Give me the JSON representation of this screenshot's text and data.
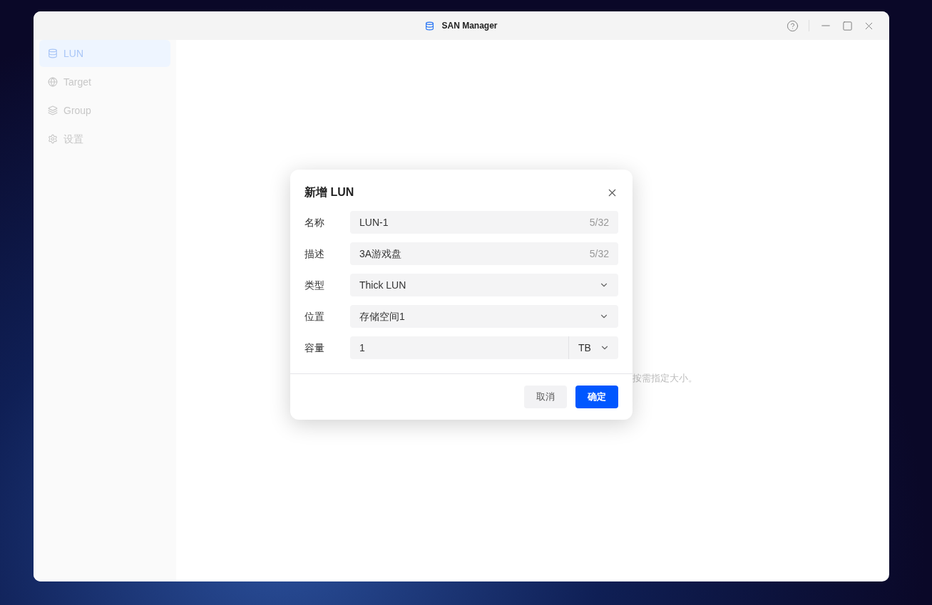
{
  "window": {
    "title": "SAN Manager"
  },
  "sidebar": {
    "items": [
      {
        "label": "LUN",
        "kind": "database",
        "selected": true
      },
      {
        "label": "Target",
        "kind": "globe",
        "selected": false
      },
      {
        "label": "Group",
        "kind": "layers",
        "selected": false
      },
      {
        "label": "设置",
        "kind": "gear",
        "selected": false
      }
    ]
  },
  "background_text": "按需指定大小。",
  "dialog": {
    "title": "新增 LUN",
    "fields": [
      {
        "label": "名称",
        "kind": "text",
        "value": "LUN-1",
        "counter": "5/32"
      },
      {
        "label": "描述",
        "kind": "text",
        "value": "3A游戏盘",
        "counter": "5/32"
      },
      {
        "label": "类型",
        "kind": "select",
        "value": "Thick LUN"
      },
      {
        "label": "位置",
        "kind": "select",
        "value": "存储空间1"
      },
      {
        "label": "容量",
        "kind": "size",
        "value": "1",
        "unit": "TB"
      }
    ],
    "buttons": [
      {
        "label": "取消",
        "kind": "secondary"
      },
      {
        "label": "确定",
        "kind": "primary"
      }
    ]
  }
}
